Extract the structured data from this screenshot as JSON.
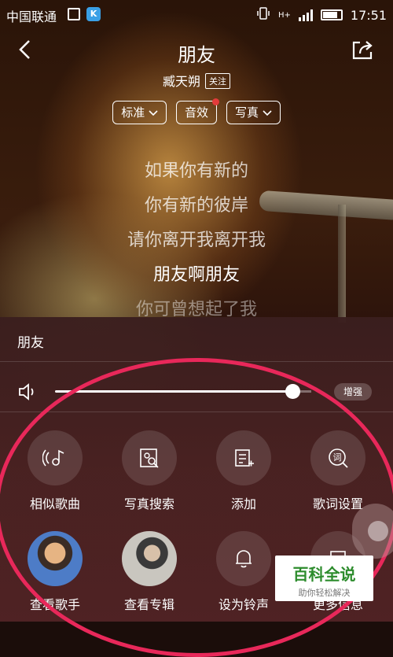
{
  "statusbar": {
    "carrier": "中国联通",
    "network": "H+",
    "time": "17:51",
    "app_badge": "K"
  },
  "header": {
    "title": "朋友",
    "artist": "臧天朔",
    "follow_label": "关注"
  },
  "options": [
    {
      "label": "标准",
      "dropdown": true
    },
    {
      "label": "音效",
      "dot": true
    },
    {
      "label": "写真",
      "dropdown": true
    }
  ],
  "lyrics": [
    "如果你有新的",
    "你有新的彼岸",
    "请你离开我离开我",
    "朋友啊朋友",
    "你可曾想起了我"
  ],
  "panel": {
    "song_title": "朋友",
    "volume_level_percent": 93,
    "boost_label": "增强",
    "actions": [
      {
        "label": "相似歌曲",
        "icon": "similar-songs-icon"
      },
      {
        "label": "写真搜索",
        "icon": "photo-search-icon"
      },
      {
        "label": "添加",
        "icon": "add-to-list-icon"
      },
      {
        "label": "歌词设置",
        "icon": "lyrics-settings-icon"
      },
      {
        "label": "查看歌手",
        "icon": "singer-avatar"
      },
      {
        "label": "查看专辑",
        "icon": "album-cover"
      },
      {
        "label": "设为铃声",
        "icon": "bell-icon"
      },
      {
        "label": "更多信息",
        "icon": "info-icon"
      }
    ]
  },
  "watermark": {
    "main": "百科全说",
    "sub": "助你轻松解决"
  },
  "colors": {
    "highlight_ring": "#e8285a",
    "red_dot": "#e23b3b"
  }
}
